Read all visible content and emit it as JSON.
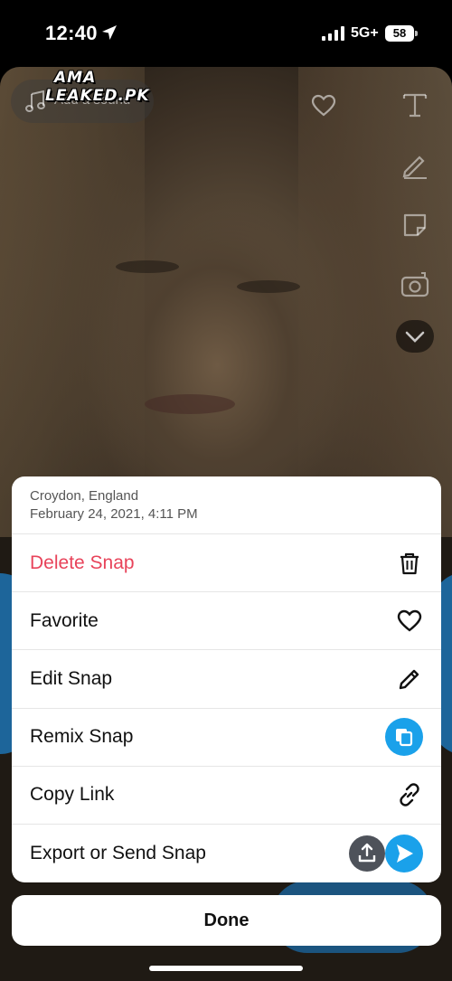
{
  "status_bar": {
    "time": "12:40",
    "network": "5G+",
    "battery": "58",
    "icons": [
      "location-arrow-icon",
      "cellular-signal-icon",
      "battery-icon"
    ]
  },
  "preview": {
    "sound_label": "Add a sound",
    "watermark_line1": "AMA",
    "watermark_line2": "LEAKED.PK",
    "tools": [
      "text-tool-icon",
      "pencil-tool-icon",
      "sticker-tool-icon",
      "camera-flip-icon",
      "chevron-down-icon",
      "heart-icon"
    ]
  },
  "sheet": {
    "location": "Croydon, England",
    "date": "February 24, 2021, 4:11 PM",
    "items": [
      {
        "label": "Delete Snap",
        "icon": "trash-icon",
        "style": "danger"
      },
      {
        "label": "Favorite",
        "icon": "heart-icon"
      },
      {
        "label": "Edit Snap",
        "icon": "pencil-icon"
      },
      {
        "label": "Remix Snap",
        "icon": "remix-icon"
      },
      {
        "label": "Copy Link",
        "icon": "link-icon"
      },
      {
        "label": "Export or Send Snap",
        "icon": "export-send-icons"
      }
    ]
  },
  "done_label": "Done",
  "colors": {
    "danger": "#e8435a",
    "accent_blue": "#1aa1ea",
    "export_gray": "#4e525a"
  }
}
